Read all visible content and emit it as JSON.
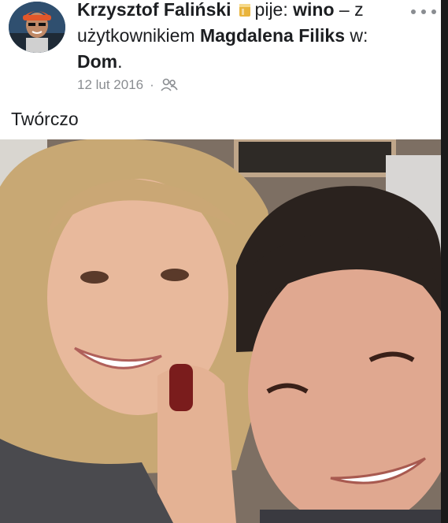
{
  "post": {
    "author": "Krzysztof Faliński",
    "activity_verb": "pije:",
    "activity_object": "wino",
    "with_prefix": " – z użytkownikiem ",
    "tagged_user": "Magdalena Filiks",
    "location_prefix": " w: ",
    "location": "Dom",
    "location_suffix": ".",
    "date": "12 lut 2016",
    "separator": "·",
    "audience_icon": "friends-icon",
    "text": "Twórczo",
    "more_icon": "more-options-icon"
  },
  "colors": {
    "text": "#1c1e21",
    "meta": "#8a8d91",
    "background": "#ffffff"
  }
}
